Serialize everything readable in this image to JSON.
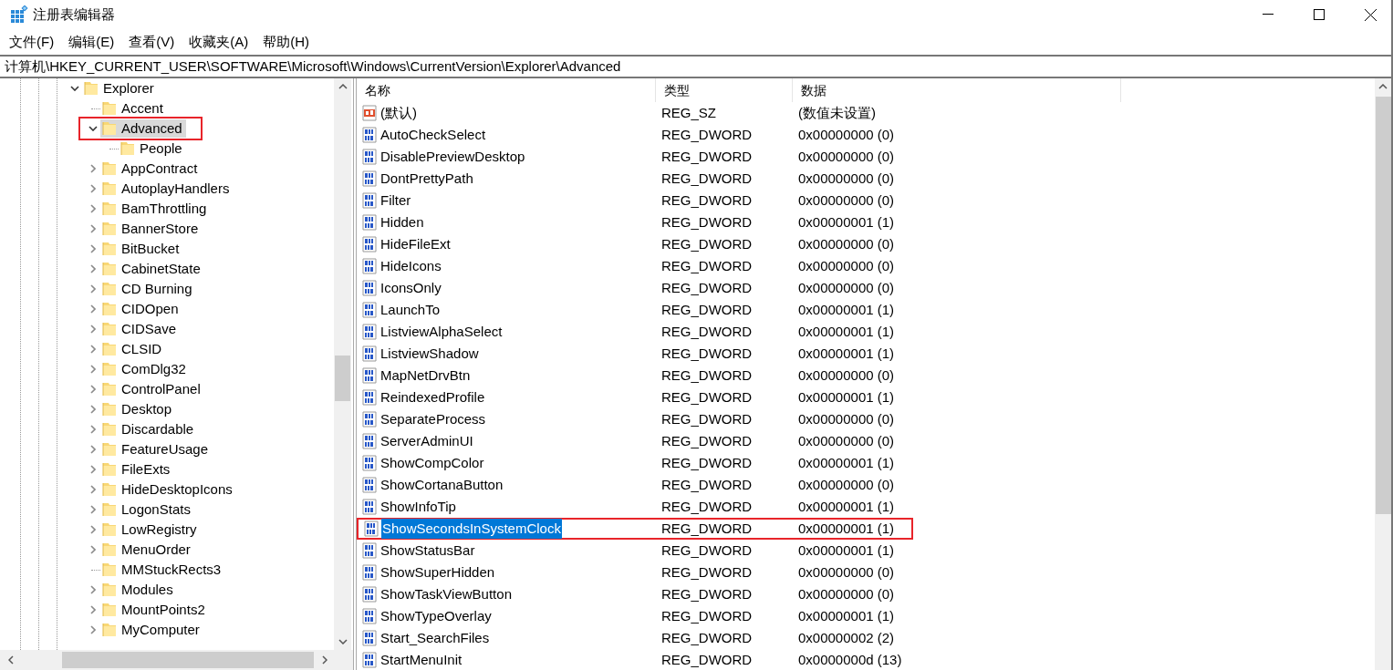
{
  "window": {
    "title": "注册表编辑器"
  },
  "menu": [
    "文件(F)",
    "编辑(E)",
    "查看(V)",
    "收藏夹(A)",
    "帮助(H)"
  ],
  "address": "计算机\\HKEY_CURRENT_USER\\SOFTWARE\\Microsoft\\Windows\\CurrentVersion\\Explorer\\Advanced",
  "tree": [
    {
      "label": "Explorer",
      "kind": "branch",
      "expanded": true,
      "selected": false,
      "annotated": false,
      "children": [
        {
          "label": "Accent",
          "kind": "leaf",
          "selected": false,
          "annotated": false
        },
        {
          "label": "Advanced",
          "kind": "branch",
          "expanded": true,
          "selected": true,
          "annotated": true,
          "children": [
            {
              "label": "People",
              "kind": "leaf",
              "selected": false,
              "annotated": false
            }
          ]
        },
        {
          "label": "AppContract",
          "kind": "branch",
          "expanded": false,
          "selected": false,
          "annotated": false
        },
        {
          "label": "AutoplayHandlers",
          "kind": "branch",
          "expanded": false,
          "selected": false,
          "annotated": false
        },
        {
          "label": "BamThrottling",
          "kind": "branch",
          "expanded": false,
          "selected": false,
          "annotated": false
        },
        {
          "label": "BannerStore",
          "kind": "branch",
          "expanded": false,
          "selected": false,
          "annotated": false
        },
        {
          "label": "BitBucket",
          "kind": "branch",
          "expanded": false,
          "selected": false,
          "annotated": false
        },
        {
          "label": "CabinetState",
          "kind": "branch",
          "expanded": false,
          "selected": false,
          "annotated": false
        },
        {
          "label": "CD Burning",
          "kind": "branch",
          "expanded": false,
          "selected": false,
          "annotated": false
        },
        {
          "label": "CIDOpen",
          "kind": "branch",
          "expanded": false,
          "selected": false,
          "annotated": false
        },
        {
          "label": "CIDSave",
          "kind": "branch",
          "expanded": false,
          "selected": false,
          "annotated": false
        },
        {
          "label": "CLSID",
          "kind": "branch",
          "expanded": false,
          "selected": false,
          "annotated": false
        },
        {
          "label": "ComDlg32",
          "kind": "branch",
          "expanded": false,
          "selected": false,
          "annotated": false
        },
        {
          "label": "ControlPanel",
          "kind": "branch",
          "expanded": false,
          "selected": false,
          "annotated": false
        },
        {
          "label": "Desktop",
          "kind": "branch",
          "expanded": false,
          "selected": false,
          "annotated": false
        },
        {
          "label": "Discardable",
          "kind": "branch",
          "expanded": false,
          "selected": false,
          "annotated": false
        },
        {
          "label": "FeatureUsage",
          "kind": "branch",
          "expanded": false,
          "selected": false,
          "annotated": false
        },
        {
          "label": "FileExts",
          "kind": "branch",
          "expanded": false,
          "selected": false,
          "annotated": false
        },
        {
          "label": "HideDesktopIcons",
          "kind": "branch",
          "expanded": false,
          "selected": false,
          "annotated": false
        },
        {
          "label": "LogonStats",
          "kind": "branch",
          "expanded": false,
          "selected": false,
          "annotated": false
        },
        {
          "label": "LowRegistry",
          "kind": "branch",
          "expanded": false,
          "selected": false,
          "annotated": false
        },
        {
          "label": "MenuOrder",
          "kind": "branch",
          "expanded": false,
          "selected": false,
          "annotated": false
        },
        {
          "label": "MMStuckRects3",
          "kind": "leaf",
          "selected": false,
          "annotated": false
        },
        {
          "label": "Modules",
          "kind": "branch",
          "expanded": false,
          "selected": false,
          "annotated": false
        },
        {
          "label": "MountPoints2",
          "kind": "branch",
          "expanded": false,
          "selected": false,
          "annotated": false
        },
        {
          "label": "MyComputer",
          "kind": "branch",
          "expanded": false,
          "selected": false,
          "annotated": false
        }
      ]
    }
  ],
  "table": {
    "columns": [
      "名称",
      "类型",
      "数据"
    ],
    "rows": [
      {
        "kind": "string",
        "name": "(默认)",
        "type": "REG_SZ",
        "data": "(数值未设置)",
        "selected": false,
        "annotated": false
      },
      {
        "kind": "dword",
        "name": "AutoCheckSelect",
        "type": "REG_DWORD",
        "data": "0x00000000 (0)",
        "selected": false,
        "annotated": false
      },
      {
        "kind": "dword",
        "name": "DisablePreviewDesktop",
        "type": "REG_DWORD",
        "data": "0x00000000 (0)",
        "selected": false,
        "annotated": false
      },
      {
        "kind": "dword",
        "name": "DontPrettyPath",
        "type": "REG_DWORD",
        "data": "0x00000000 (0)",
        "selected": false,
        "annotated": false
      },
      {
        "kind": "dword",
        "name": "Filter",
        "type": "REG_DWORD",
        "data": "0x00000000 (0)",
        "selected": false,
        "annotated": false
      },
      {
        "kind": "dword",
        "name": "Hidden",
        "type": "REG_DWORD",
        "data": "0x00000001 (1)",
        "selected": false,
        "annotated": false
      },
      {
        "kind": "dword",
        "name": "HideFileExt",
        "type": "REG_DWORD",
        "data": "0x00000000 (0)",
        "selected": false,
        "annotated": false
      },
      {
        "kind": "dword",
        "name": "HideIcons",
        "type": "REG_DWORD",
        "data": "0x00000000 (0)",
        "selected": false,
        "annotated": false
      },
      {
        "kind": "dword",
        "name": "IconsOnly",
        "type": "REG_DWORD",
        "data": "0x00000000 (0)",
        "selected": false,
        "annotated": false
      },
      {
        "kind": "dword",
        "name": "LaunchTo",
        "type": "REG_DWORD",
        "data": "0x00000001 (1)",
        "selected": false,
        "annotated": false
      },
      {
        "kind": "dword",
        "name": "ListviewAlphaSelect",
        "type": "REG_DWORD",
        "data": "0x00000001 (1)",
        "selected": false,
        "annotated": false
      },
      {
        "kind": "dword",
        "name": "ListviewShadow",
        "type": "REG_DWORD",
        "data": "0x00000001 (1)",
        "selected": false,
        "annotated": false
      },
      {
        "kind": "dword",
        "name": "MapNetDrvBtn",
        "type": "REG_DWORD",
        "data": "0x00000000 (0)",
        "selected": false,
        "annotated": false
      },
      {
        "kind": "dword",
        "name": "ReindexedProfile",
        "type": "REG_DWORD",
        "data": "0x00000001 (1)",
        "selected": false,
        "annotated": false
      },
      {
        "kind": "dword",
        "name": "SeparateProcess",
        "type": "REG_DWORD",
        "data": "0x00000000 (0)",
        "selected": false,
        "annotated": false
      },
      {
        "kind": "dword",
        "name": "ServerAdminUI",
        "type": "REG_DWORD",
        "data": "0x00000000 (0)",
        "selected": false,
        "annotated": false
      },
      {
        "kind": "dword",
        "name": "ShowCompColor",
        "type": "REG_DWORD",
        "data": "0x00000001 (1)",
        "selected": false,
        "annotated": false
      },
      {
        "kind": "dword",
        "name": "ShowCortanaButton",
        "type": "REG_DWORD",
        "data": "0x00000000 (0)",
        "selected": false,
        "annotated": false
      },
      {
        "kind": "dword",
        "name": "ShowInfoTip",
        "type": "REG_DWORD",
        "data": "0x00000001 (1)",
        "selected": false,
        "annotated": false
      },
      {
        "kind": "dword",
        "name": "ShowSecondsInSystemClock",
        "type": "REG_DWORD",
        "data": "0x00000001 (1)",
        "selected": true,
        "annotated": true
      },
      {
        "kind": "dword",
        "name": "ShowStatusBar",
        "type": "REG_DWORD",
        "data": "0x00000001 (1)",
        "selected": false,
        "annotated": false
      },
      {
        "kind": "dword",
        "name": "ShowSuperHidden",
        "type": "REG_DWORD",
        "data": "0x00000000 (0)",
        "selected": false,
        "annotated": false
      },
      {
        "kind": "dword",
        "name": "ShowTaskViewButton",
        "type": "REG_DWORD",
        "data": "0x00000000 (0)",
        "selected": false,
        "annotated": false
      },
      {
        "kind": "dword",
        "name": "ShowTypeOverlay",
        "type": "REG_DWORD",
        "data": "0x00000001 (1)",
        "selected": false,
        "annotated": false
      },
      {
        "kind": "dword",
        "name": "Start_SearchFiles",
        "type": "REG_DWORD",
        "data": "0x00000002 (2)",
        "selected": false,
        "annotated": false
      },
      {
        "kind": "dword",
        "name": "StartMenuInit",
        "type": "REG_DWORD",
        "data": "0x0000000d (13)",
        "selected": false,
        "annotated": false
      }
    ]
  }
}
